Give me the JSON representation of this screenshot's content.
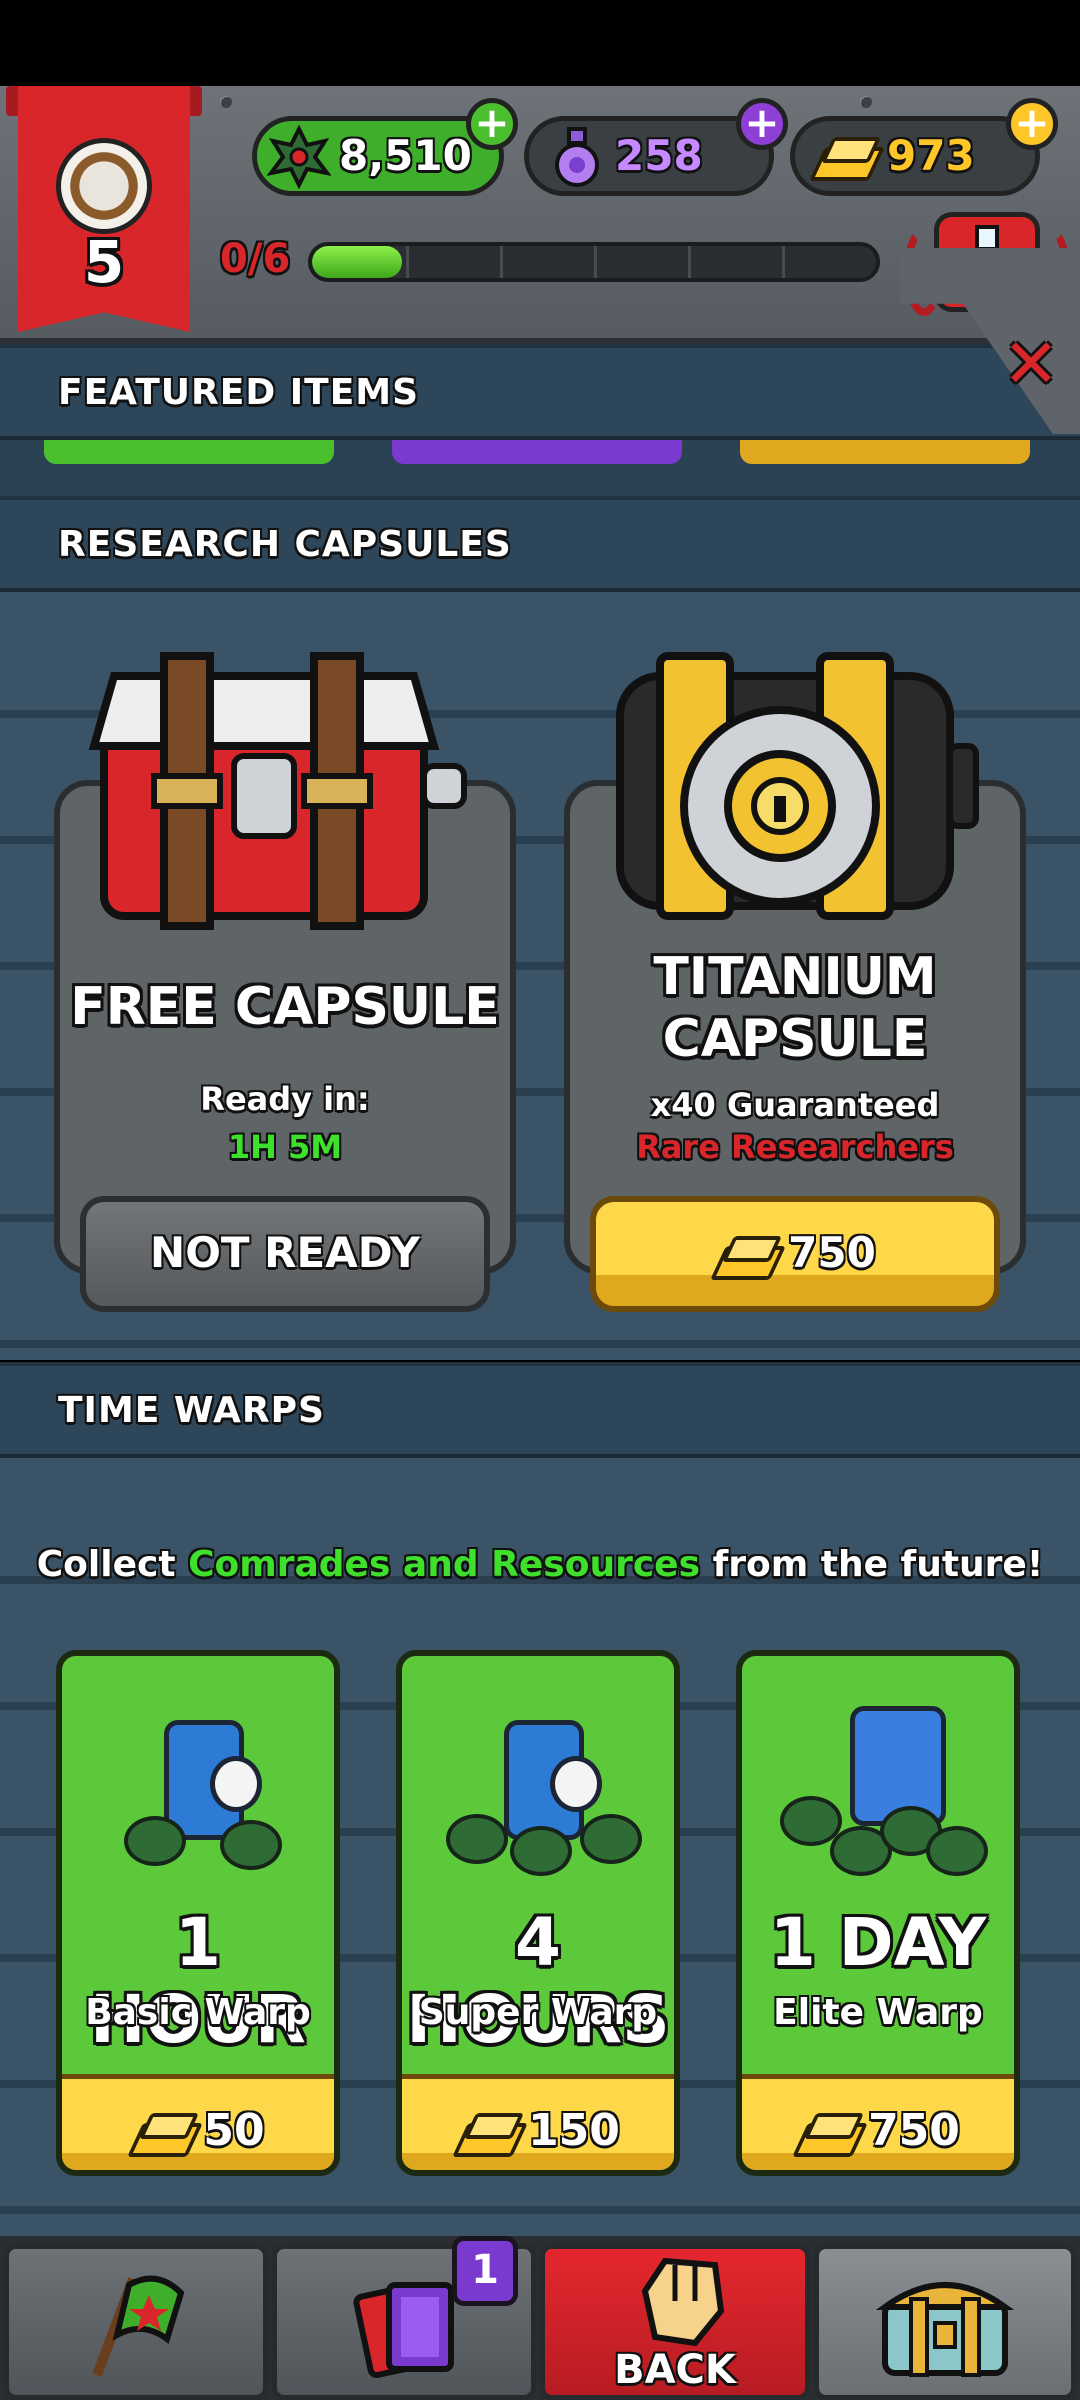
{
  "hud": {
    "level": "5",
    "resources": {
      "dust": "8,510",
      "potion": "258",
      "gold": "973"
    },
    "xp_text": "0/6",
    "xp_progress": 0.16,
    "xp_segments": 6
  },
  "sections": {
    "featured": "FEATURED ITEMS",
    "research": "RESEARCH CAPSULES",
    "time_warps": "TIME WARPS"
  },
  "capsules": {
    "free": {
      "title": "FREE CAPSULE",
      "ready_label": "Ready in:",
      "timer": "1H 5M",
      "button": "NOT READY"
    },
    "titanium": {
      "title_line1": "TITANIUM",
      "title_line2": "CAPSULE",
      "guaranteed": "x40 Guaranteed",
      "rarity": "Rare Researchers",
      "price": "750"
    }
  },
  "warps": {
    "tagline_pre": "Collect ",
    "tagline_highlight": "Comrades and Resources",
    "tagline_post": " from the future!",
    "items": [
      {
        "title": "1 HOUR",
        "subtitle": "Basic Warp",
        "price": "50"
      },
      {
        "title": "4 HOURS",
        "subtitle": "Super Warp",
        "price": "150"
      },
      {
        "title": "1 DAY",
        "subtitle": "Elite Warp",
        "price": "750"
      }
    ]
  },
  "nav": {
    "cards_badge": "1",
    "back_label": "BACK"
  },
  "colors": {
    "accent_red": "#d8262b",
    "highlight_green": "#3fe02c",
    "rare_red": "#d8262b",
    "gold": "#ffd84a",
    "card_green": "#5bc93a"
  },
  "icons": [
    "spiked-wheel-icon",
    "dust-icon",
    "potion-icon",
    "gold-bar-icon",
    "plus-icon",
    "flask-icon",
    "close-icon",
    "red-chest-icon",
    "vault-icon",
    "time-warp-icon",
    "flag-icon",
    "cards-icon",
    "fist-icon",
    "treasure-chest-icon"
  ]
}
